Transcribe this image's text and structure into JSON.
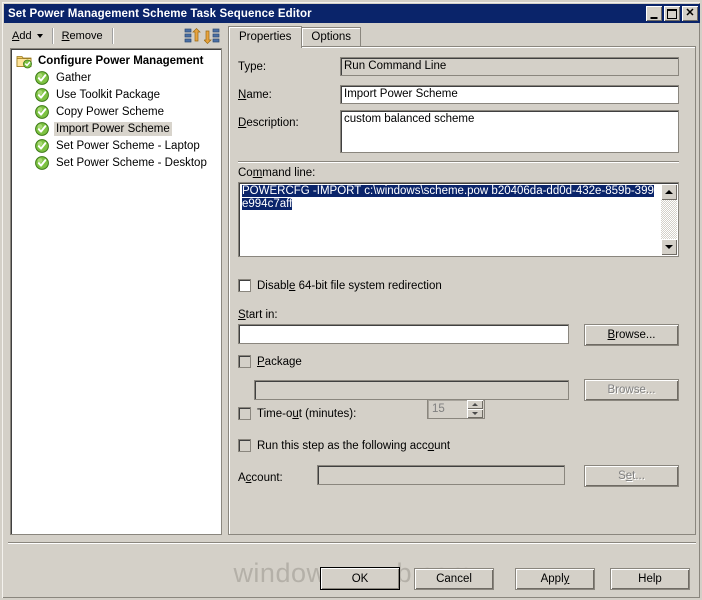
{
  "window": {
    "title": "Set Power Management Scheme Task Sequence Editor",
    "controls": {
      "minimize": "–",
      "maximize": "□",
      "close": "✕"
    }
  },
  "toolbar": {
    "add_label": "Add",
    "remove_label": "Remove",
    "icon_move_up": "move-up-icon",
    "icon_move_down": "move-down-icon"
  },
  "tree": {
    "items": [
      {
        "label": "Configure Power Management",
        "icon": "folder-check-icon",
        "level": 0,
        "selected": false
      },
      {
        "label": "Gather",
        "icon": "green-check-icon",
        "level": 1,
        "selected": false
      },
      {
        "label": "Use Toolkit Package",
        "icon": "green-check-icon",
        "level": 1,
        "selected": false
      },
      {
        "label": "Copy Power Scheme",
        "icon": "green-check-icon",
        "level": 1,
        "selected": false
      },
      {
        "label": "Import Power Scheme",
        "icon": "green-check-icon",
        "level": 1,
        "selected": true
      },
      {
        "label": "Set Power Scheme - Laptop",
        "icon": "green-check-icon",
        "level": 1,
        "selected": false
      },
      {
        "label": "Set Power Scheme - Desktop",
        "icon": "green-check-icon",
        "level": 1,
        "selected": false
      }
    ]
  },
  "tabs": [
    {
      "label": "Properties",
      "active": true
    },
    {
      "label": "Options",
      "active": false
    }
  ],
  "properties": {
    "type_label": "Type:",
    "type_value": "Run Command Line",
    "name_label": "Name:",
    "name_value": "Import Power Scheme",
    "description_label": "Description:",
    "description_value": "custom balanced scheme",
    "command_line_label": "Command line:",
    "command_line_value": "POWERCFG -IMPORT c:\\windows\\scheme.pow b20406da-dd0d-432e-859b-399e994c7aff",
    "disable_redirection_label": "Disable 64-bit file system redirection",
    "disable_redirection_checked": false,
    "start_in_label": "Start in:",
    "start_in_value": "",
    "start_in_browse_label": "Browse...",
    "package_label": "Package",
    "package_checked": false,
    "package_value": "",
    "package_browse_label": "Browse...",
    "timeout_label": "Time-out (minutes):",
    "timeout_checked": false,
    "timeout_value": "15",
    "run_as_label": "Run this step as the following account",
    "run_as_checked": false,
    "account_label": "Account:",
    "account_value": "",
    "account_set_label": "Set..."
  },
  "footer": {
    "ok_label": "OK",
    "cancel_label": "Cancel",
    "apply_label": "Apply",
    "help_label": "Help"
  },
  "watermark": {
    "text": "windows-noob.com"
  },
  "colors": {
    "titlebar": "#0a246a",
    "dialog_bg": "#d4d0c8",
    "selection": "#0a246a",
    "field_bg": "#ffffff",
    "disabled_text": "#808080"
  }
}
